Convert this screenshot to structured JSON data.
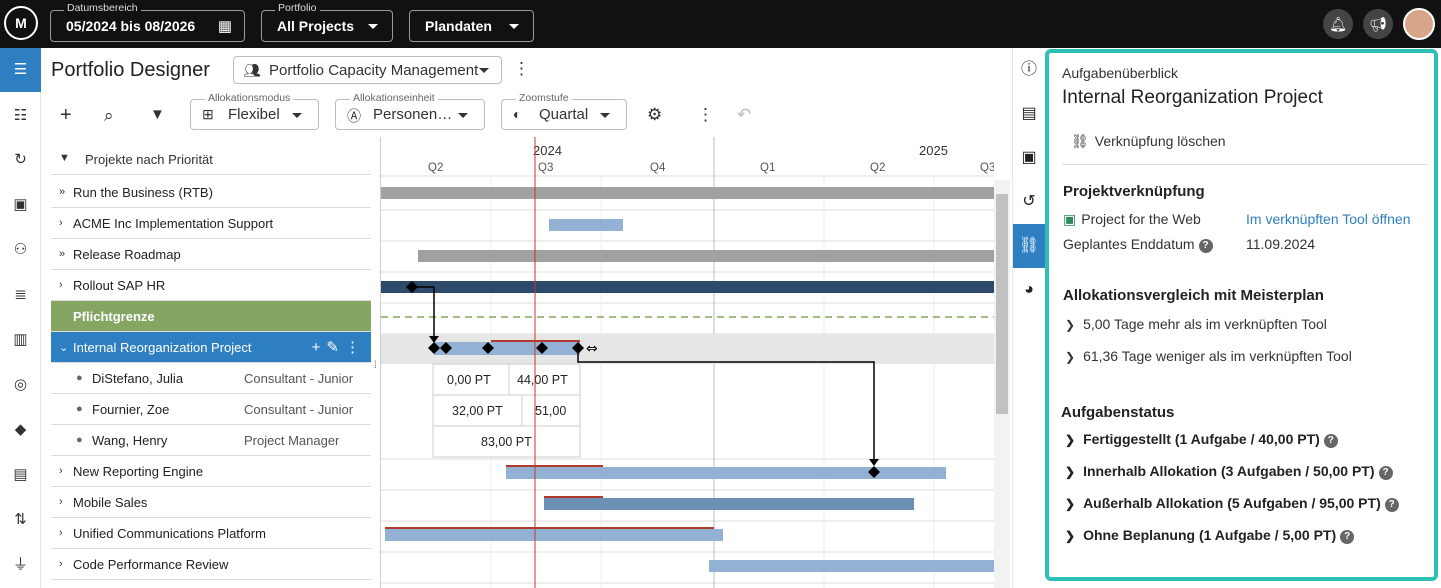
{
  "topbar": {
    "logo": "M",
    "date_range": {
      "label": "Datumsbereich",
      "value": "05/2024 bis 08/2026"
    },
    "portfolio": {
      "label": "Portfolio",
      "value": "All Projects"
    },
    "plan": {
      "value": "Plandaten"
    },
    "icons": [
      "bell-icon",
      "megaphone-icon",
      "avatar"
    ]
  },
  "page": {
    "title": "Portfolio Designer",
    "view_select": "Portfolio Capacity Management"
  },
  "toolbar": {
    "alloc_mode": {
      "label": "Allokationsmodus",
      "value": "Flexibel"
    },
    "alloc_unit": {
      "label": "Allokationseinheit",
      "value": "Personen…"
    },
    "zoom": {
      "label": "Zoomstufe",
      "value": "Quartal"
    }
  },
  "tree": {
    "header": "Projekte nach Priorität",
    "rows": [
      {
        "name": "Run the Business (RTB)"
      },
      {
        "name": "ACME Inc Implementation Support"
      },
      {
        "name": "Release Roadmap"
      },
      {
        "name": "Rollout SAP HR"
      },
      {
        "name": "Pflichtgrenze"
      },
      {
        "name": "Internal Reorganization Project"
      },
      {
        "name": "DiStefano, Julia",
        "role": "Consultant - Junior"
      },
      {
        "name": "Fournier, Zoe",
        "role": "Consultant - Junior"
      },
      {
        "name": "Wang, Henry",
        "role": "Project Manager"
      },
      {
        "name": "New Reporting Engine"
      },
      {
        "name": "Mobile Sales"
      },
      {
        "name": "Unified Communications Platform"
      },
      {
        "name": "Code Performance Review"
      }
    ]
  },
  "timeline": {
    "years": [
      "2024",
      "2025"
    ],
    "quarters": [
      "Q2",
      "Q3",
      "Q4",
      "Q1",
      "Q2",
      "Q3"
    ],
    "alloc_cells": [
      "0,00 PT",
      "44,00 PT",
      "32,00 PT",
      "51,00",
      "83,00 PT"
    ]
  },
  "panel": {
    "subtitle": "Aufgabenüberblick",
    "title": "Internal Reorganization Project",
    "unlink": "Verknüpfung löschen",
    "link_heading": "Projektverknüpfung",
    "linked_project": "Project for the Web",
    "open_link": "Im verknüpften Tool öffnen",
    "planned_end_label": "Geplantes Enddatum",
    "planned_end_value": "11.09.2024",
    "compare_heading": "Allokationsvergleich mit Meisterplan",
    "compare_items": [
      "5,00 Tage mehr als im verknüpften Tool",
      "61,36 Tage weniger als im verknüpften Tool"
    ],
    "status_heading": "Aufgabenstatus",
    "status_items": [
      "Fertiggestellt (1 Aufgabe / 40,00 PT)",
      "Innerhalb Allokation (3 Aufgaben / 50,00 PT)",
      "Außerhalb Allokation (5 Aufgaben / 95,00 PT)",
      "Ohne Beplanung (1 Aufgabe / 5,00 PT)"
    ]
  },
  "colors": {
    "accent": "#2e7fc1",
    "panel_border": "#2cc1b2",
    "pflicht": "#84a662",
    "today_line": "#c0392b"
  }
}
